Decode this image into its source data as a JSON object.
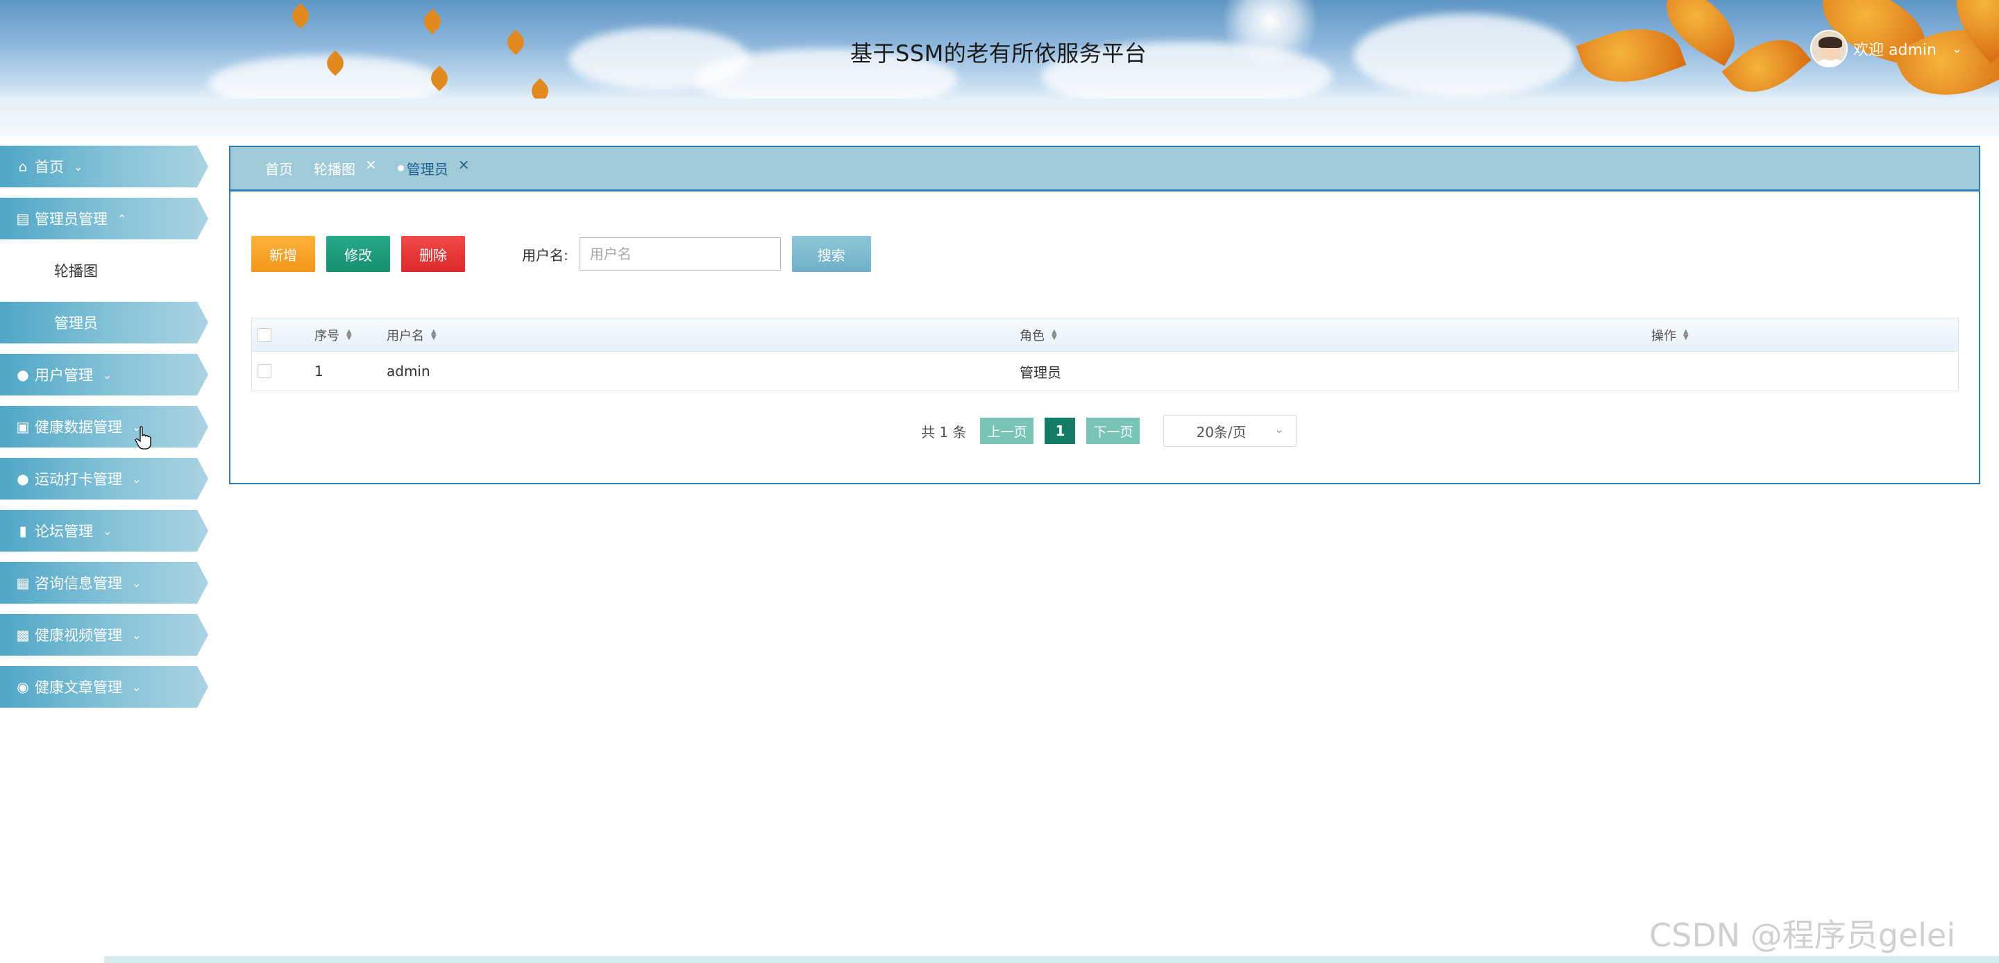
{
  "header": {
    "title": "基于SSM的老有所依服务平台",
    "welcome": "欢迎 admin"
  },
  "sidebar": {
    "items": [
      {
        "label": "首页",
        "icon": "home-icon"
      },
      {
        "label": "管理员管理",
        "icon": "gift-icon",
        "expanded": true,
        "children": [
          {
            "label": "轮播图"
          },
          {
            "label": "管理员",
            "active": true
          }
        ]
      },
      {
        "label": "用户管理",
        "icon": "user-icon"
      },
      {
        "label": "健康数据管理",
        "icon": "laptop-icon"
      },
      {
        "label": "运动打卡管理",
        "icon": "drop-icon"
      },
      {
        "label": "论坛管理",
        "icon": "book-icon"
      },
      {
        "label": "咨询信息管理",
        "icon": "building-icon"
      },
      {
        "label": "健康视频管理",
        "icon": "video-icon"
      },
      {
        "label": "健康文章管理",
        "icon": "chat-icon"
      }
    ]
  },
  "tabs": [
    {
      "label": "首页",
      "closable": false
    },
    {
      "label": "轮播图",
      "closable": true
    },
    {
      "label": "管理员",
      "closable": true,
      "active": true
    }
  ],
  "toolbar": {
    "add_label": "新增",
    "edit_label": "修改",
    "delete_label": "删除",
    "search_label": "用户名:",
    "search_placeholder": "用户名",
    "search_button": "搜索"
  },
  "table": {
    "columns": [
      "序号",
      "用户名",
      "角色",
      "操作"
    ],
    "rows": [
      {
        "no": "1",
        "username": "admin",
        "role": "管理员",
        "op": ""
      }
    ]
  },
  "pager": {
    "total": "共 1 条",
    "prev": "上一页",
    "current": "1",
    "next": "下一页",
    "page_size": "20条/页"
  },
  "watermark": "CSDN @程序员gelei",
  "colors": {
    "accent": "#2b7fb8",
    "nav_gradient_start": "#4fa6c6",
    "add": "#f39617",
    "edit": "#16906f",
    "delete": "#dd2929",
    "current_page": "#137b66"
  }
}
